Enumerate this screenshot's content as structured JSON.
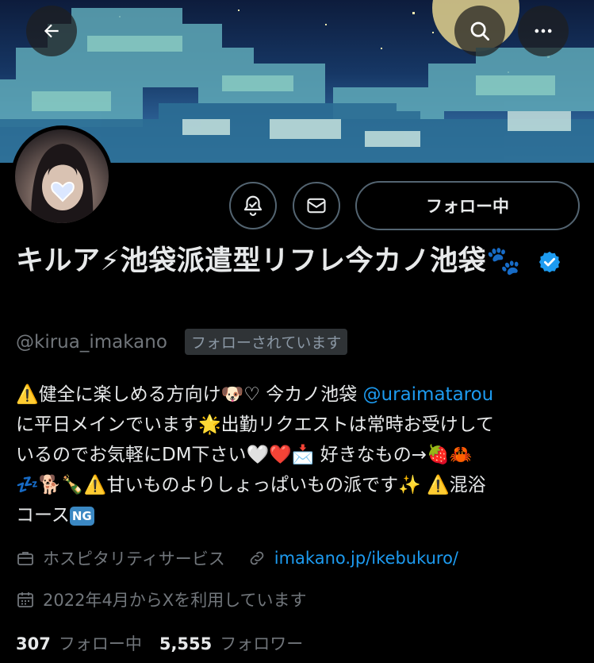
{
  "header": {
    "back_icon": "arrow-left-icon",
    "search_icon": "search-icon",
    "more_icon": "more-horizontal-icon"
  },
  "profile": {
    "name": "キルア⚡池袋派遣型リフレ今カノ池袋🐾",
    "handle": "@kirua_imakano",
    "follows_you": "フォローされています",
    "follow_button": "フォロー中",
    "bio": {
      "line1_a": "⚠️健全に楽しめる方向け🐶♡ 今カノ池袋 ",
      "mention": "@uraimatarou",
      "line2": "に平日メインでいます🌟出勤リクエストは常時お受けして",
      "line3": "いるのでお気軽にDM下さい🤍❤️📩 好きなもの→🍓🦀",
      "line4": "💤🐕🍾⚠️甘いものよりしょっぱいもの派です✨ ⚠️混浴",
      "line5": "コース",
      "ng": "NG"
    },
    "category": "ホスピタリティサービス",
    "website": "imakano.jp/ikebukuro/",
    "joined": "2022年4月からXを利用しています",
    "following_count": "307",
    "following_label": "フォロー中",
    "followers_count": "5,555",
    "followers_label": "フォロワー"
  },
  "colors": {
    "accent": "#1d9bf0",
    "muted": "#71767b",
    "border": "#536471",
    "background": "#000000"
  }
}
